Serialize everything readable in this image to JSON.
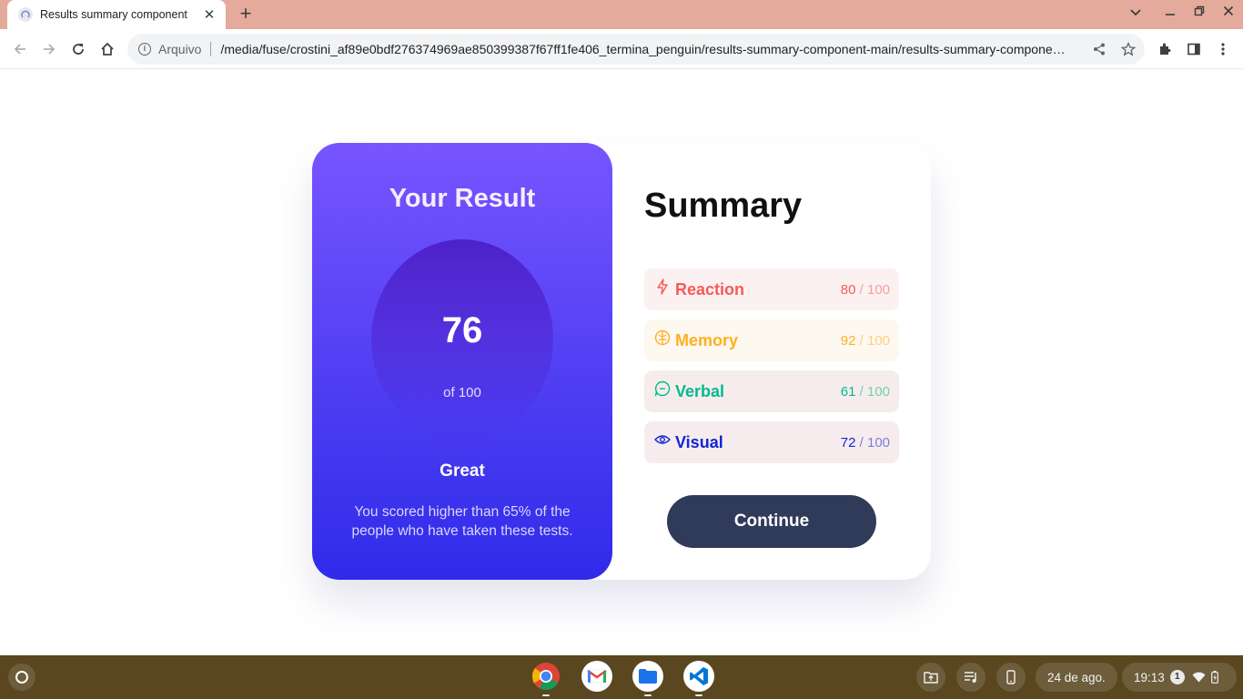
{
  "browser": {
    "tab_title": "Results summary component",
    "tab_close": "✕",
    "new_tab": "+",
    "scheme_label": "Arquivo",
    "url": "/media/fuse/crostini_af89e0bdf276374969ae850399387f67ff1fe406_termina_penguin/results-summary-component-main/results-summary-compone…"
  },
  "result": {
    "heading": "Your Result",
    "score": "76",
    "out_of": "of 100",
    "grade": "Great",
    "description": "You scored higher than 65% of the people who have taken these tests."
  },
  "summary": {
    "heading": "Summary",
    "items": [
      {
        "label": "Reaction",
        "score": "80",
        "total": " / 100",
        "icon": "lightning-icon",
        "color": "#f55a5a",
        "bg": "#fbf1f1"
      },
      {
        "label": "Memory",
        "score": "92",
        "total": " / 100",
        "icon": "brain-icon",
        "color": "#ffb01f",
        "bg": "#fdf8f0"
      },
      {
        "label": "Verbal",
        "score": "61",
        "total": " / 100",
        "icon": "speech-bubble-icon",
        "color": "#00bb8f",
        "bg": "#f6ecec"
      },
      {
        "label": "Visual",
        "score": "72",
        "total": " / 100",
        "icon": "eye-icon",
        "color": "#1125d4",
        "bg": "#f7eced"
      }
    ],
    "continue_label": "Continue"
  },
  "shelf": {
    "date": "24 de ago.",
    "time": "19:13",
    "notifications": "1",
    "apps": [
      "chrome-icon",
      "gmail-icon",
      "files-icon",
      "vscode-icon"
    ]
  },
  "colors": {
    "accent_gradient_top": "#7755ff",
    "accent_gradient_bottom": "#2f2be9",
    "button": "#303b5a",
    "tabbar": "#e4aa9c",
    "shelf": "#5a4720"
  }
}
